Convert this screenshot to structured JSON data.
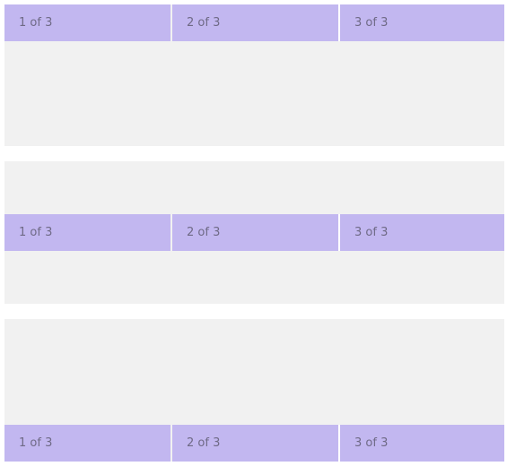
{
  "rows": [
    {
      "align": "start",
      "cols": [
        "1 of 3",
        "2 of 3",
        "3 of 3"
      ]
    },
    {
      "align": "center",
      "cols": [
        "1 of 3",
        "2 of 3",
        "3 of 3"
      ]
    },
    {
      "align": "end",
      "cols": [
        "1 of 3",
        "2 of 3",
        "3 of 3"
      ]
    }
  ],
  "colors": {
    "row_background": "#f1f1f1",
    "column_background": "#c2b7f0",
    "column_text": "#6f6a86"
  }
}
